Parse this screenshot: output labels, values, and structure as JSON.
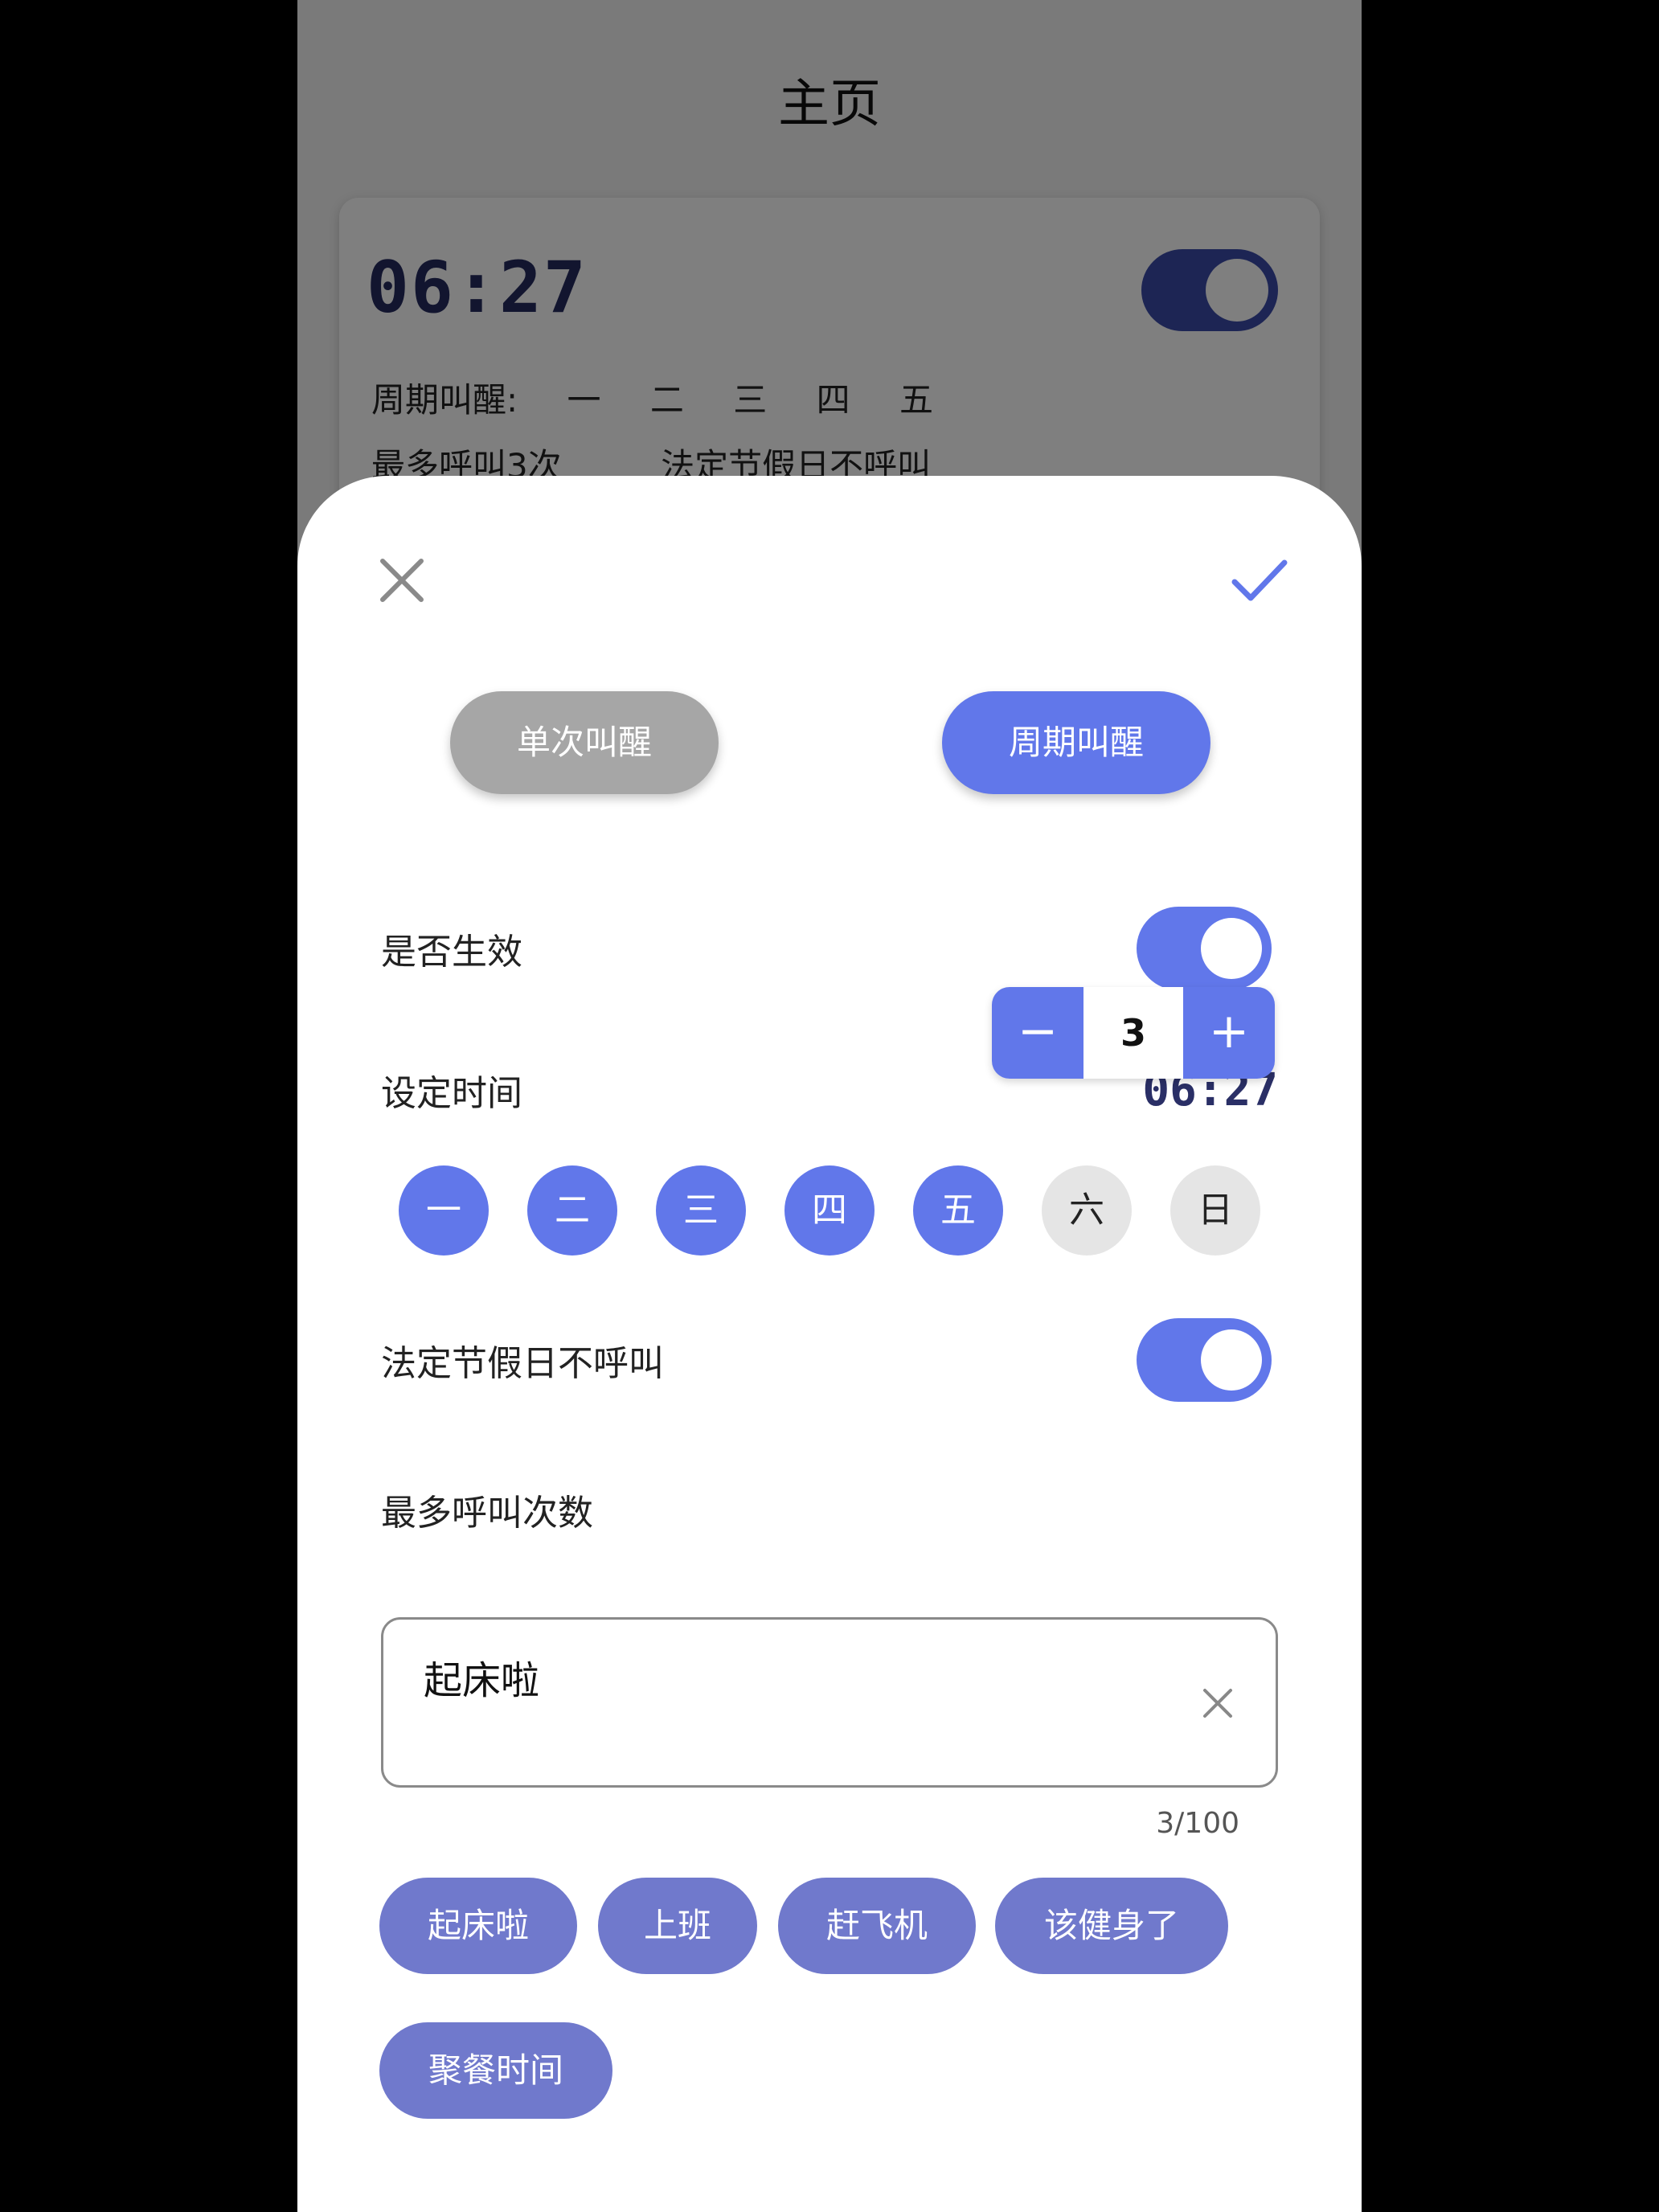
{
  "background_page": {
    "title": "主页",
    "alarm_card": {
      "time": "06:27",
      "enabled": true,
      "repeat_label": "周期叫醒:",
      "repeat_days": [
        "一",
        "二",
        "三",
        "四",
        "五"
      ],
      "max_calls": "最多呼叫3次",
      "holiday_note": "法定节假日不呼叫"
    }
  },
  "sheet": {
    "close_icon": "close-icon",
    "confirm_icon": "check-icon",
    "modes": {
      "single": "单次叫醒",
      "periodic": "周期叫醒",
      "selected": "periodic"
    },
    "enabled": {
      "label": "是否生效",
      "value": true
    },
    "set_time": {
      "label": "设定时间",
      "value": "06:27"
    },
    "weekdays": [
      {
        "label": "一",
        "selected": true
      },
      {
        "label": "二",
        "selected": true
      },
      {
        "label": "三",
        "selected": true
      },
      {
        "label": "四",
        "selected": true
      },
      {
        "label": "五",
        "selected": true
      },
      {
        "label": "六",
        "selected": false
      },
      {
        "label": "日",
        "selected": false
      }
    ],
    "holiday": {
      "label": "法定节假日不呼叫",
      "value": true
    },
    "max_calls": {
      "label": "最多呼叫次数",
      "value": "3",
      "minus": "−",
      "plus": "+"
    },
    "message": {
      "value": "起床啦",
      "counter": "3/100"
    },
    "quick_chips": [
      "起床啦",
      "上班",
      "赶飞机",
      "该健身了",
      "聚餐时间"
    ]
  },
  "colors": {
    "accent": "#6177ea",
    "chip": "#7079cc",
    "inactive_mode": "#a6a6a6",
    "inactive_day": "#e5e5e5",
    "digit": "#2a2f66"
  }
}
